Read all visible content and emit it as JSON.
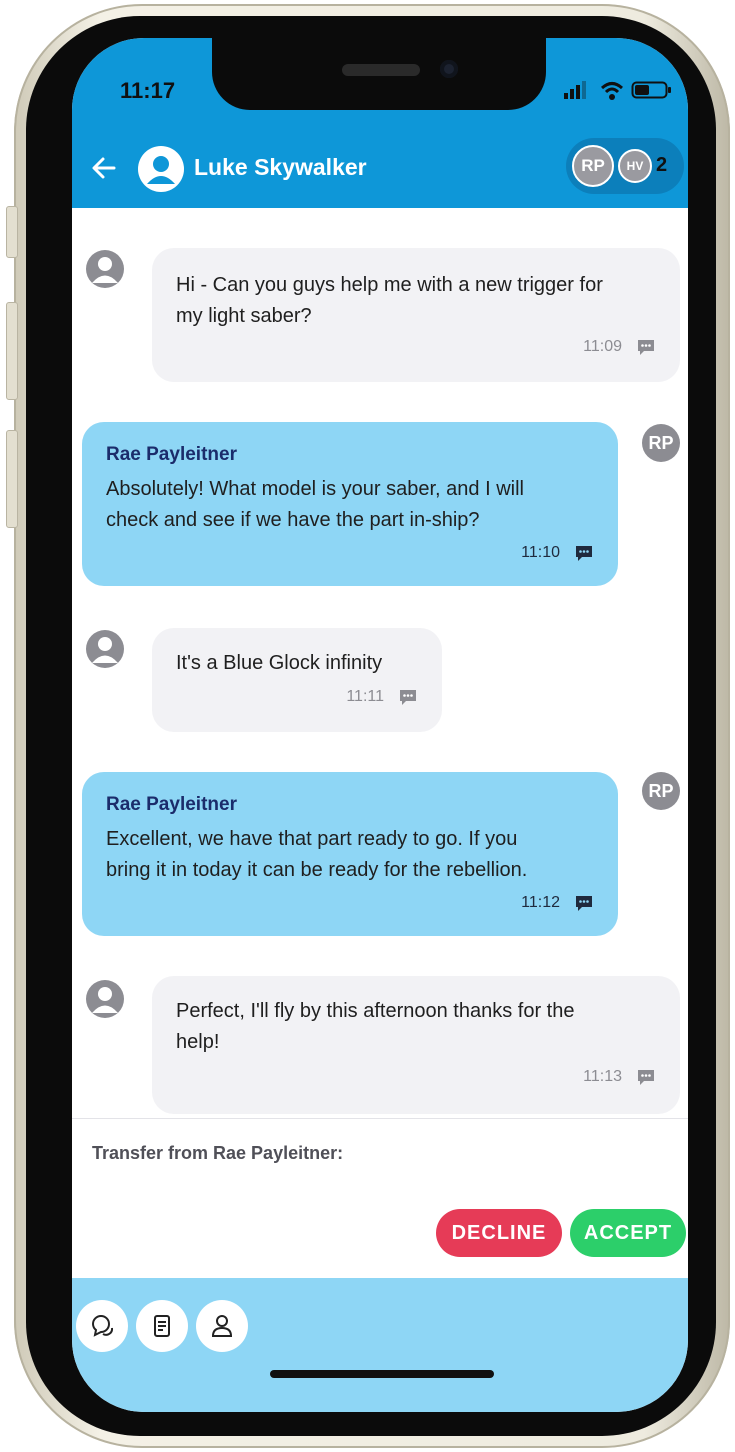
{
  "status_bar": {
    "time": "11:17"
  },
  "header": {
    "contact_name": "Luke Skywalker",
    "participants": [
      {
        "initials": "RP"
      },
      {
        "initials": "HV"
      }
    ],
    "participant_count": "2"
  },
  "messages": [
    {
      "sender": "",
      "text_lines": [
        "Hi - Can you guys help me with a new trigger for",
        "my light saber?"
      ],
      "time": "11:09"
    },
    {
      "sender": "Rae Payleitner",
      "avatar_initials": "RP",
      "text_lines": [
        "Absolutely! What model is your saber, and I will",
        "check and see if we have the part in-ship?"
      ],
      "time": "11:10"
    },
    {
      "sender": "",
      "text_lines": [
        "It's a Blue Glock infinity"
      ],
      "time": "11:11"
    },
    {
      "sender": "Rae Payleitner",
      "avatar_initials": "RP",
      "text_lines": [
        "Excellent, we have that part ready to go. If you",
        "bring it in today it can be ready for the rebellion."
      ],
      "time": "11:12"
    },
    {
      "sender": "",
      "text_lines": [
        "Perfect, I'll fly by this afternoon thanks for the",
        "help!"
      ],
      "time": "11:13"
    }
  ],
  "transfer": {
    "label": "Transfer from Rae Payleitner:",
    "decline_label": "DECLINE",
    "accept_label": "ACCEPT"
  },
  "bottom_tabs": [
    {
      "icon": "chat-bubbles-icon"
    },
    {
      "icon": "document-icon"
    },
    {
      "icon": "person-icon"
    }
  ],
  "colors": {
    "header_blue": "#0e97d8",
    "outgoing_bubble": "#8ed6f5",
    "incoming_bubble": "#f2f2f5",
    "decline_red": "#e63b57",
    "accept_green": "#2ccf6a"
  }
}
